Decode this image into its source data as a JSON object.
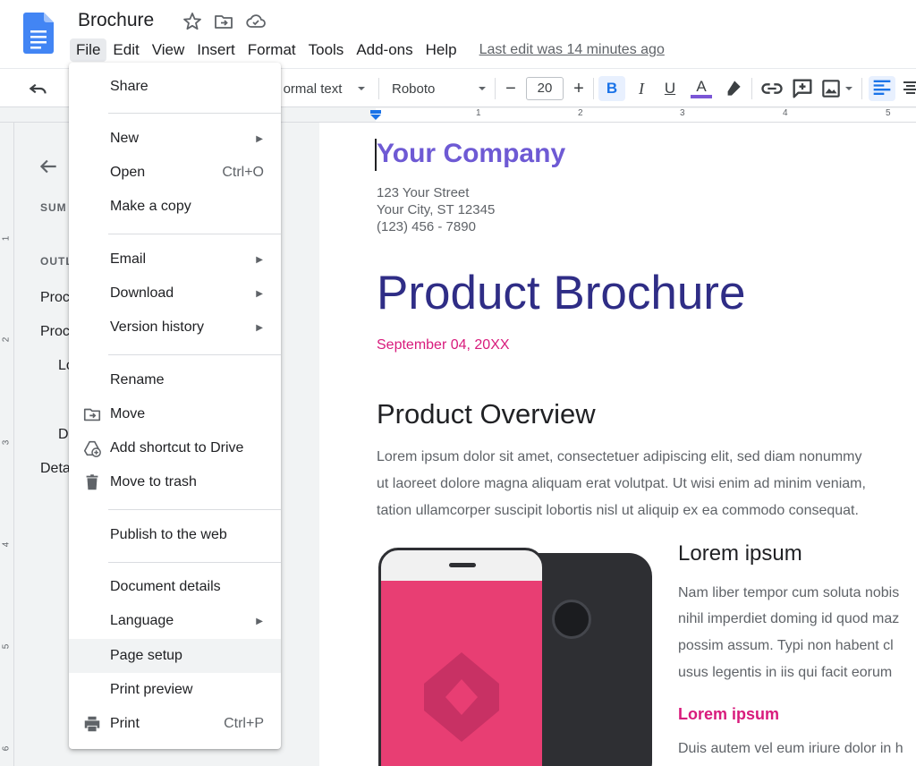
{
  "app": {
    "doc_title": "Brochure",
    "last_edit": "Last edit was 14 minutes ago",
    "accent_color": "#1a73e8"
  },
  "menubar": {
    "items": [
      "File",
      "Edit",
      "View",
      "Insert",
      "Format",
      "Tools",
      "Add-ons",
      "Help"
    ],
    "active": "File"
  },
  "toolbar": {
    "style": "ormal text",
    "font": "Roboto",
    "font_size": "20",
    "minus": "−",
    "plus": "+",
    "bold": "B",
    "italic": "I",
    "underline": "U",
    "text_color_label": "A"
  },
  "ruler": {
    "numbers": [
      "1",
      "2",
      "3",
      "4",
      "5"
    ],
    "vertical_numbers": [
      "1",
      "2",
      "3",
      "4",
      "5",
      "6"
    ]
  },
  "outline": {
    "summary_label": "SUM",
    "outline_label": "OUTL",
    "items": [
      "Proc",
      "Proc",
      "Lo",
      "D",
      "Deta"
    ]
  },
  "file_menu": {
    "items": [
      {
        "label": "Share",
        "shortcut": "",
        "submenu": false,
        "icon": ""
      },
      {
        "label": "New",
        "shortcut": "",
        "submenu": true,
        "icon": ""
      },
      {
        "label": "Open",
        "shortcut": "Ctrl+O",
        "submenu": false,
        "icon": ""
      },
      {
        "label": "Make a copy",
        "shortcut": "",
        "submenu": false,
        "icon": ""
      },
      {
        "label": "Email",
        "shortcut": "",
        "submenu": true,
        "icon": ""
      },
      {
        "label": "Download",
        "shortcut": "",
        "submenu": true,
        "icon": ""
      },
      {
        "label": "Version history",
        "shortcut": "",
        "submenu": true,
        "icon": ""
      },
      {
        "label": "Rename",
        "shortcut": "",
        "submenu": false,
        "icon": ""
      },
      {
        "label": "Move",
        "shortcut": "",
        "submenu": false,
        "icon": "move-folder-icon"
      },
      {
        "label": "Add shortcut to Drive",
        "shortcut": "",
        "submenu": false,
        "icon": "add-shortcut-icon"
      },
      {
        "label": "Move to trash",
        "shortcut": "",
        "submenu": false,
        "icon": "trash-icon"
      },
      {
        "label": "Publish to the web",
        "shortcut": "",
        "submenu": false,
        "icon": ""
      },
      {
        "label": "Document details",
        "shortcut": "",
        "submenu": false,
        "icon": ""
      },
      {
        "label": "Language",
        "shortcut": "",
        "submenu": true,
        "icon": ""
      },
      {
        "label": "Page setup",
        "shortcut": "",
        "submenu": false,
        "icon": "",
        "hovered": true
      },
      {
        "label": "Print preview",
        "shortcut": "",
        "submenu": false,
        "icon": ""
      },
      {
        "label": "Print",
        "shortcut": "Ctrl+P",
        "submenu": false,
        "icon": "printer-icon"
      }
    ]
  },
  "document": {
    "company": "Your Company",
    "address": [
      "123 Your Street",
      "Your City, ST 12345",
      "(123) 456 - 7890"
    ],
    "title": "Product Brochure",
    "date": "September 04, 20XX",
    "section_heading": "Product Overview",
    "overview_lines": [
      "Lorem ipsum dolor sit amet, consectetuer adipiscing elit, sed diam nonummy",
      "ut laoreet dolore magna aliquam erat volutpat. Ut wisi enim ad minim veniam,",
      "tation ullamcorper suscipit lobortis nisl ut aliquip ex ea commodo consequat."
    ],
    "sub_heading": "Lorem ipsum",
    "sub_lines": [
      "Nam liber tempor cum soluta nobis",
      "nihil imperdiet doming id quod maz",
      "possim assum. Typi non habent cl",
      "usus legentis in iis qui facit eorum"
    ],
    "sub_heading2": "Lorem ipsum",
    "sub_line2": "Duis autem vel eum iriure dolor in h",
    "title_color": "#2f2d86",
    "company_color": "#6e5ad4",
    "date_color": "#d81b7c"
  }
}
